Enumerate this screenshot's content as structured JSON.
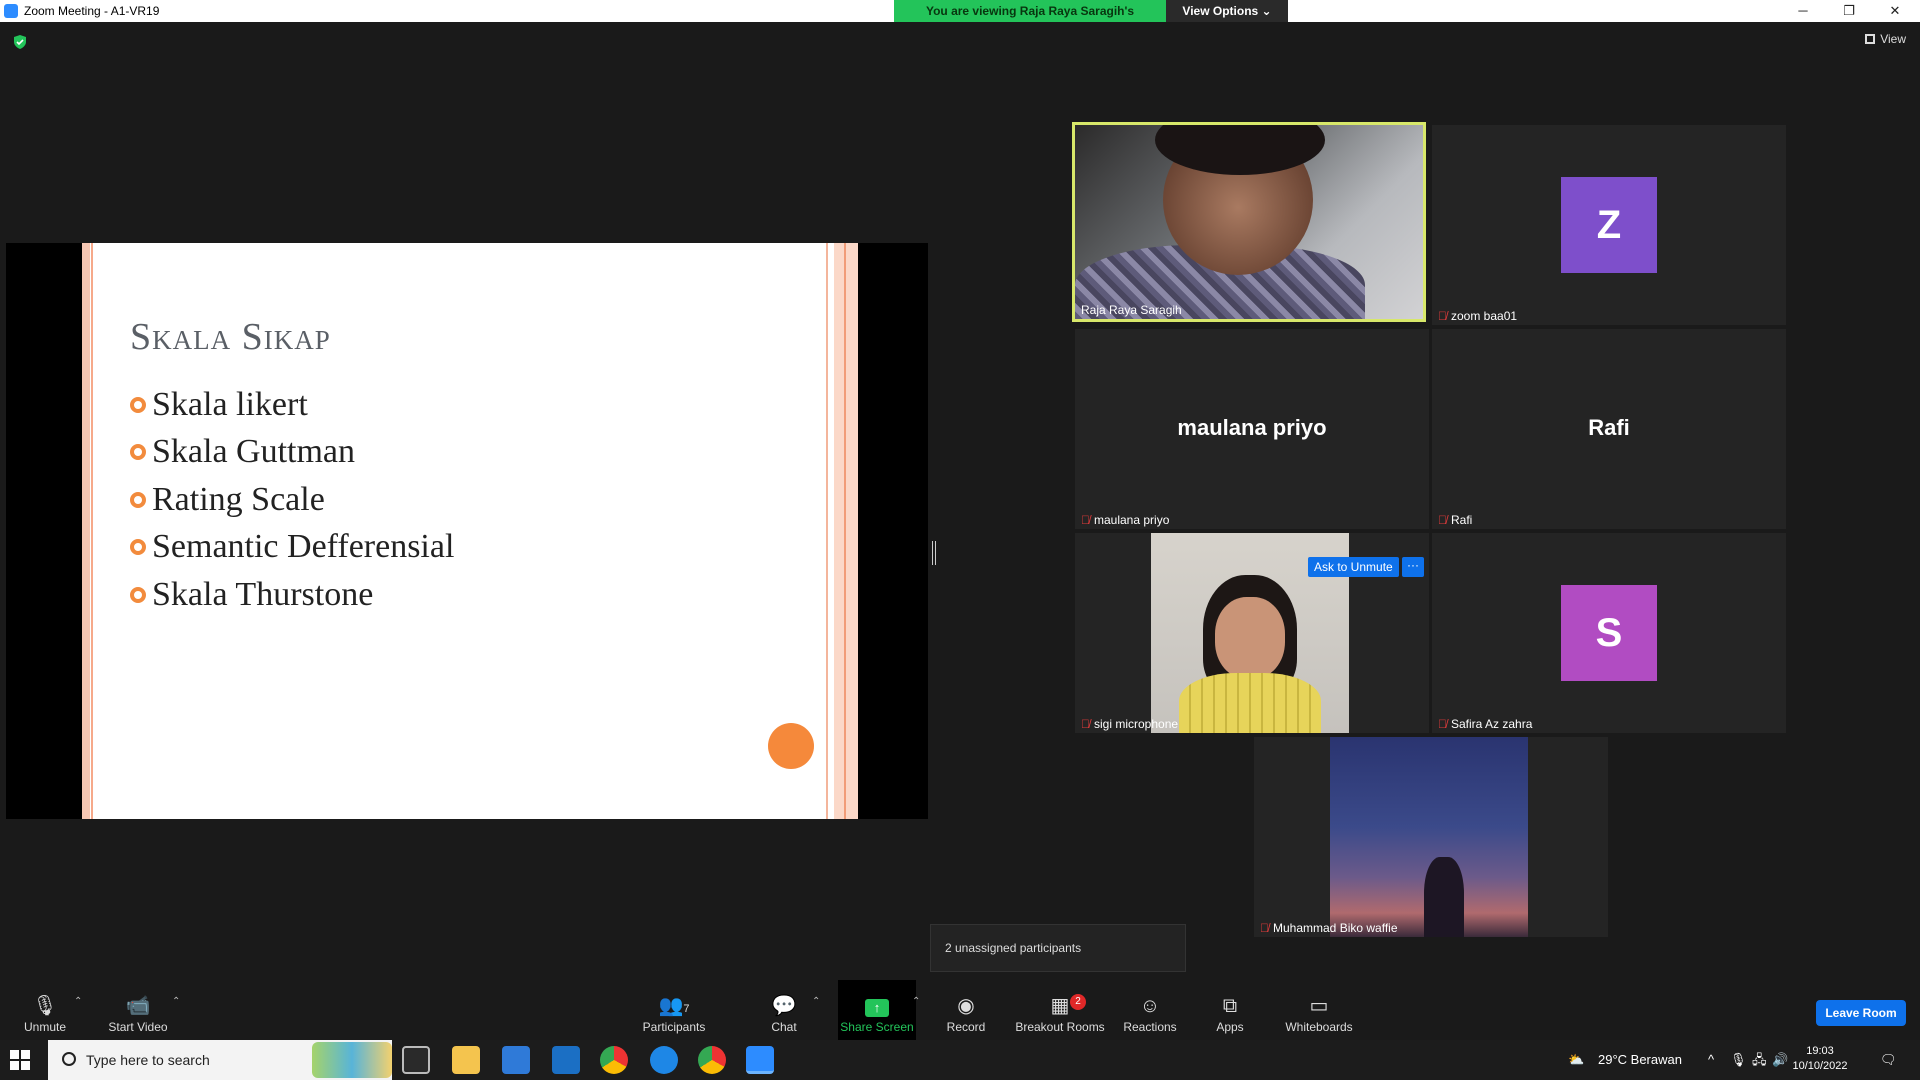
{
  "window": {
    "title": "Zoom Meeting - A1-VR19",
    "minimize": "─",
    "restore": "❐",
    "close": "✕"
  },
  "banner": {
    "viewing": "You are viewing Raja Raya Saragih's screen",
    "view_options": "View Options ⌄"
  },
  "top_right": {
    "view_label": "View"
  },
  "slide": {
    "title": "Skala Sikap",
    "bullets": [
      "Skala likert",
      "Skala Guttman",
      "Rating Scale",
      "Semantic Defferensial",
      "Skala Thurstone"
    ]
  },
  "participants": [
    {
      "name": "Raja Raya Saragih",
      "type": "video",
      "active": true,
      "muted": false
    },
    {
      "name": "zoom baa01",
      "type": "avatar",
      "initial": "Z",
      "color": "#7e4fcb",
      "muted": true
    },
    {
      "name": "maulana priyo",
      "type": "name",
      "muted": true
    },
    {
      "name": "Rafi",
      "type": "name",
      "muted": true
    },
    {
      "name": "sigi microphone",
      "type": "photo",
      "muted": true
    },
    {
      "name": "Safira Az zahra",
      "type": "avatar",
      "initial": "S",
      "color": "#b14cc2",
      "muted": true
    },
    {
      "name": "Muhammad Biko waffie",
      "type": "photo",
      "muted": true
    }
  ],
  "hover_controls": {
    "ask_unmute": "Ask to Unmute",
    "more": "···"
  },
  "tooltip": "2 unassigned participants",
  "toolbar": {
    "unmute": "Unmute",
    "start_video": "Start Video",
    "participants": "Participants",
    "participants_count": "7",
    "chat": "Chat",
    "share_screen": "Share Screen",
    "record": "Record",
    "breakout_rooms": "Breakout Rooms",
    "breakout_badge": "2",
    "reactions": "Reactions",
    "apps": "Apps",
    "whiteboards": "Whiteboards",
    "leave": "Leave Room"
  },
  "taskbar": {
    "search_placeholder": "Type here to search",
    "weather": "29°C  Berawan",
    "time": "19:03",
    "date": "10/10/2022"
  },
  "colors": {
    "accent_blue": "#0e71eb",
    "green": "#23c45a",
    "active_border": "#d8e86a",
    "slide_bullet": "#f28b3d"
  }
}
